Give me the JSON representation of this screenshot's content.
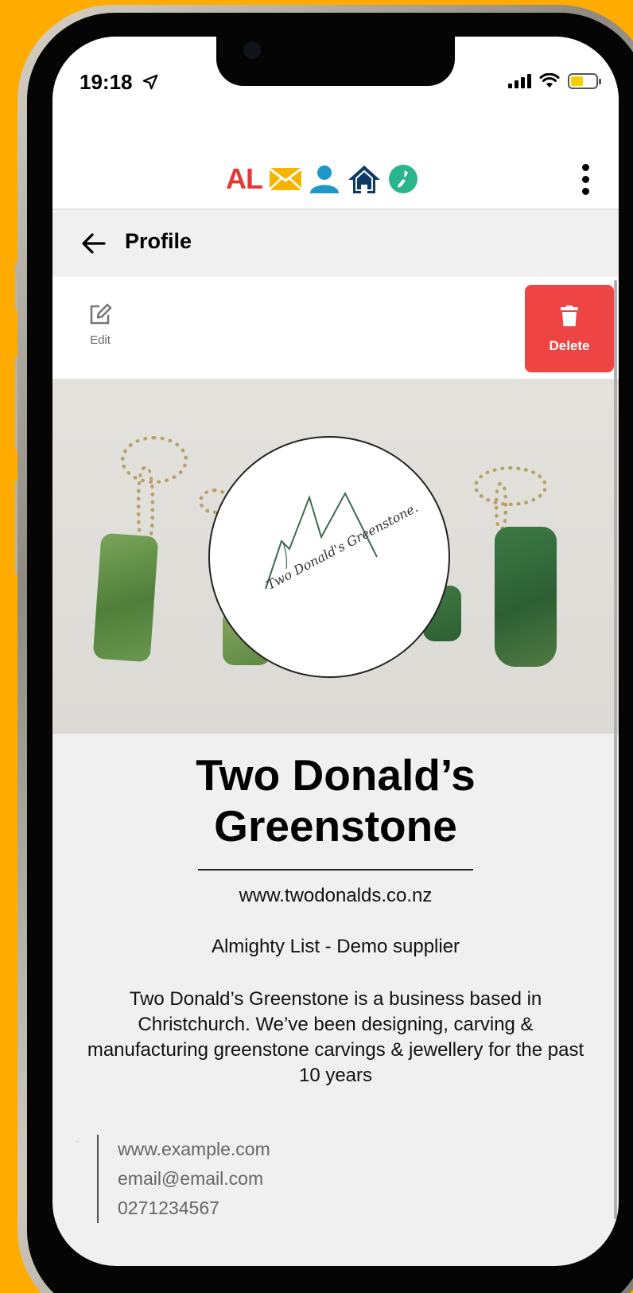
{
  "status_bar": {
    "time": "19:18"
  },
  "app_header": {
    "logo_text": "AL",
    "icons": [
      "mail-icon",
      "user-icon",
      "home-icon",
      "new-zealand-map-icon"
    ],
    "menu_icon": "more-vertical-icon"
  },
  "page": {
    "title": "Profile",
    "back_icon": "back-arrow-icon"
  },
  "actions": {
    "edit_label": "Edit",
    "delete_label": "Delete"
  },
  "profile": {
    "name": "Two Donald’s Greenstone",
    "logo_script": "Two Donald's Greenstone.",
    "website": "www.twodonalds.co.nz",
    "category": "Almighty List - Demo supplier",
    "description": "Two Donald’s Greenstone is a business based in Christchurch. We’ve been designing, carving & manufacturing greenstone carvings & jewellery for the past 10 years",
    "contact": {
      "marker": "-",
      "website": "www.example.com",
      "email": "email@email.com",
      "phone": "0271234567"
    }
  },
  "colors": {
    "background": "#ffab00",
    "delete": "#ef4444",
    "logo_red": "#e53935",
    "mail_yellow": "#f6b400",
    "user_blue": "#2196c8",
    "home_navy": "#0d3b66",
    "map_green": "#2bb58f"
  }
}
